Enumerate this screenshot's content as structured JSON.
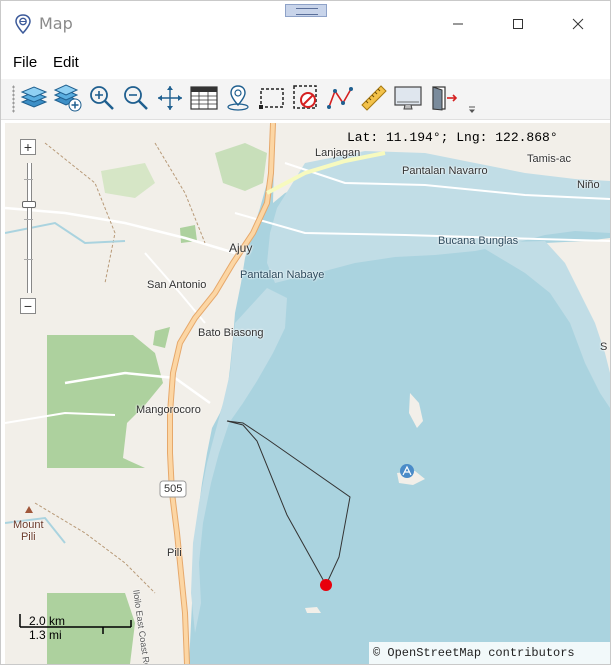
{
  "window": {
    "title": "Map"
  },
  "menu": {
    "file": "File",
    "edit": "Edit"
  },
  "toolbar": {
    "icons": [
      "layers-icon",
      "add-layer-icon",
      "zoom-in-icon",
      "zoom-out-icon",
      "pan-icon",
      "attribute-table-icon",
      "add-marker-icon",
      "select-rectangle-icon",
      "clear-selection-icon",
      "draw-line-icon",
      "measure-ruler-icon",
      "screenshot-icon",
      "exit-icon"
    ]
  },
  "map": {
    "coordinates": "Lat: 11.194°; Lng: 122.868°",
    "places": {
      "lanjagan": "Lanjagan",
      "tamisac": "Tamis-ac",
      "nino": "Niño",
      "pantalan_navarro": "Pantalan Navarro",
      "ajuy": "Ajuy",
      "bucana_bunglas": "Bucana Bunglas",
      "pantalan_nabaye": "Pantalan Nabaye",
      "san_antonio": "San Antonio",
      "bato_biasong": "Bato Biasong",
      "s_edge": "S",
      "mangorocoro": "Mangorocoro",
      "mount_pili": "Mount\nPili",
      "pili": "Pili",
      "road_505": "505",
      "east_coast_road": "Iloilo East Coast Road"
    },
    "scale": {
      "km": "2.0 km",
      "mi": "1.3 mi"
    },
    "attribution": "© OpenStreetMap contributors",
    "zoom": {
      "plus": "+",
      "minus": "−"
    },
    "colors": {
      "water": "#aad3df",
      "land": "#f2efe9",
      "forest": "#add19e",
      "road": "#fcd6a4",
      "marker": "#e8000b"
    }
  }
}
